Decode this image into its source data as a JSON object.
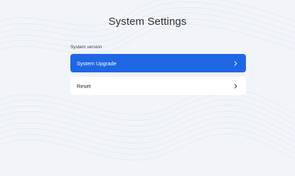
{
  "page": {
    "title": "System Settings"
  },
  "section": {
    "label": "System version",
    "items": [
      {
        "label": "System Upgrade",
        "icon": "chevron-right-icon",
        "selected": true
      },
      {
        "label": "Reset",
        "icon": "chevron-right-icon",
        "selected": false
      }
    ]
  },
  "colors": {
    "background": "#f1f4f9",
    "accent": "#1f66e5",
    "item_background": "#ffffff",
    "title_text": "#2b2f36"
  }
}
